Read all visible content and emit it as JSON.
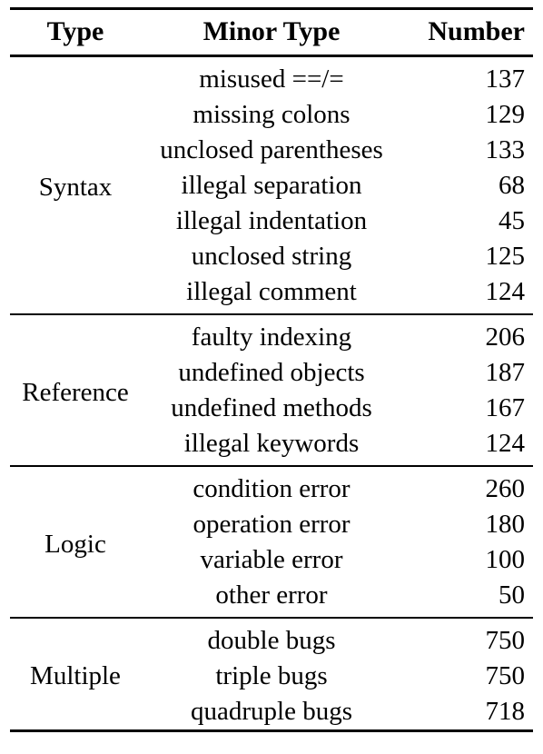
{
  "table": {
    "columns": [
      {
        "key": "type",
        "label": "Type",
        "align": "center"
      },
      {
        "key": "minor",
        "label": "Minor Type",
        "align": "center"
      },
      {
        "key": "number",
        "label": "Number",
        "align": "right"
      }
    ],
    "headers": {
      "type": "Type",
      "minor_type": "Minor Type",
      "number": "Number"
    },
    "sections": [
      {
        "type": "Syntax",
        "rows": [
          {
            "minor_type": "misused ==/=",
            "number": "137"
          },
          {
            "minor_type": "missing colons",
            "number": "129"
          },
          {
            "minor_type": "unclosed parentheses",
            "number": "133"
          },
          {
            "minor_type": "illegal separation",
            "number": "68"
          },
          {
            "minor_type": "illegal indentation",
            "number": "45"
          },
          {
            "minor_type": "unclosed string",
            "number": "125"
          },
          {
            "minor_type": "illegal comment",
            "number": "124"
          }
        ]
      },
      {
        "type": "Reference",
        "rows": [
          {
            "minor_type": "faulty indexing",
            "number": "206"
          },
          {
            "minor_type": "undefined objects",
            "number": "187"
          },
          {
            "minor_type": "undefined methods",
            "number": "167"
          },
          {
            "minor_type": "illegal keywords",
            "number": "124"
          }
        ]
      },
      {
        "type": "Logic",
        "rows": [
          {
            "minor_type": "condition error",
            "number": "260"
          },
          {
            "minor_type": "operation error",
            "number": "180"
          },
          {
            "minor_type": "variable error",
            "number": "100"
          },
          {
            "minor_type": "other error",
            "number": "50"
          }
        ]
      },
      {
        "type": "Multiple",
        "rows": [
          {
            "minor_type": "double bugs",
            "number": "750"
          },
          {
            "minor_type": "triple bugs",
            "number": "750"
          },
          {
            "minor_type": "quadruple bugs",
            "number": "718"
          }
        ]
      }
    ]
  },
  "chart_data": {
    "type": "table",
    "title": "",
    "columns": [
      "Type",
      "Minor Type",
      "Number"
    ],
    "categories": [
      "misused ==/=",
      "missing colons",
      "unclosed parentheses",
      "illegal separation",
      "illegal indentation",
      "unclosed string",
      "illegal comment",
      "faulty indexing",
      "undefined objects",
      "undefined methods",
      "illegal keywords",
      "condition error",
      "operation error",
      "variable error",
      "other error",
      "double bugs",
      "triple bugs",
      "quadruple bugs"
    ],
    "values": [
      137,
      129,
      133,
      68,
      45,
      125,
      124,
      206,
      187,
      167,
      124,
      260,
      180,
      100,
      50,
      750,
      750,
      718
    ],
    "groups": [
      {
        "name": "Syntax",
        "categories": [
          "misused ==/=",
          "missing colons",
          "unclosed parentheses",
          "illegal separation",
          "illegal indentation",
          "unclosed string",
          "illegal comment"
        ],
        "values": [
          137,
          129,
          133,
          68,
          45,
          125,
          124
        ]
      },
      {
        "name": "Reference",
        "categories": [
          "faulty indexing",
          "undefined objects",
          "undefined methods",
          "illegal keywords"
        ],
        "values": [
          206,
          187,
          167,
          124
        ]
      },
      {
        "name": "Logic",
        "categories": [
          "condition error",
          "operation error",
          "variable error",
          "other error"
        ],
        "values": [
          260,
          180,
          100,
          50
        ]
      },
      {
        "name": "Multiple",
        "categories": [
          "double bugs",
          "triple bugs",
          "quadruple bugs"
        ],
        "values": [
          750,
          750,
          718
        ]
      }
    ],
    "xlabel": "Minor Type",
    "ylabel": "Number"
  }
}
